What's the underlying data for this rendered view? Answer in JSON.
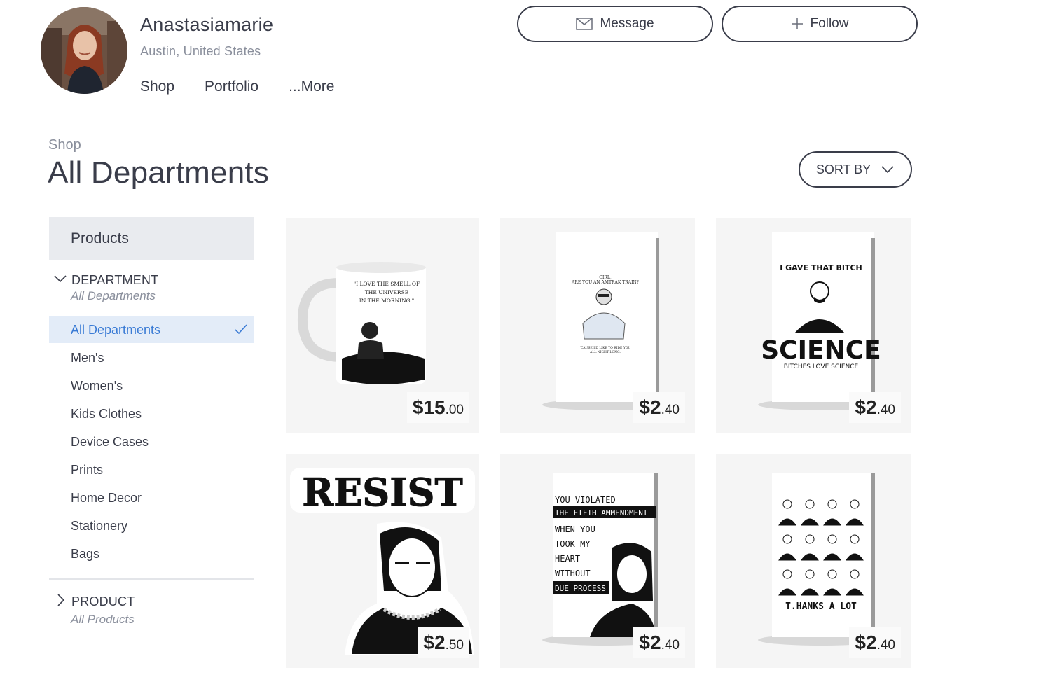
{
  "artist": {
    "name": "Anastasiamarie",
    "location": "Austin, United States",
    "nav": [
      "Shop",
      "Portfolio",
      "...More"
    ]
  },
  "actions": {
    "message_label": "Message",
    "follow_label": "Follow"
  },
  "page": {
    "breadcrumb": "Shop",
    "title": "All Departments",
    "sort_label": "SORT BY"
  },
  "sidebar": {
    "header": "Products",
    "department": {
      "title": "DEPARTMENT",
      "selected": "All Departments"
    },
    "items": [
      "All Departments",
      "Men's",
      "Women's",
      "Kids Clothes",
      "Device Cases",
      "Prints",
      "Home Decor",
      "Stationery",
      "Bags"
    ],
    "product": {
      "title": "PRODUCT",
      "selected": "All Products"
    }
  },
  "products": [
    {
      "dollars": "$15",
      "cents": ".00",
      "art_text": [
        "\"I LOVE THE SMELL OF",
        "THE UNIVERSE",
        "IN THE MORNING.\""
      ]
    },
    {
      "dollars": "$2",
      "cents": ".40",
      "art_text": [
        "GIRL,",
        "ARE YOU AN AMTRAK TRAIN?",
        "'CAUSE I'D LIKE TO RIDE YOU",
        "ALL NIGHT LONG."
      ]
    },
    {
      "dollars": "$2",
      "cents": ".40",
      "art_text": [
        "I GAVE THAT BITCH",
        "SCIENCE",
        "BITCHES LOVE SCIENCE"
      ]
    },
    {
      "dollars": "$2",
      "cents": ".50",
      "art_text": [
        "RESIST"
      ]
    },
    {
      "dollars": "$2",
      "cents": ".40",
      "art_text": [
        "YOU VIOLATED",
        "THE FIFTH AMMENDMENT",
        "WHEN YOU",
        "TOOK MY",
        "HEART",
        "WITHOUT",
        "DUE PROCESS"
      ]
    },
    {
      "dollars": "$2",
      "cents": ".40",
      "art_text": [
        "T.HANKS A LOT"
      ]
    }
  ],
  "colors": {
    "accent": "#3a7bd5",
    "text": "#3a3d4a",
    "muted": "#8a8f9c",
    "panel": "#e9ebef"
  }
}
